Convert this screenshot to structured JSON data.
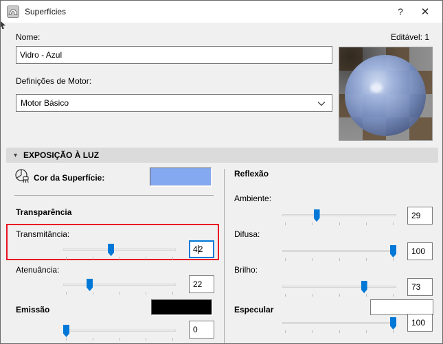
{
  "window": {
    "title": "Superfícies",
    "help_label": "?",
    "close_label": "✕"
  },
  "header": {
    "name_label": "Nome:",
    "name_value": "Vidro - Azul",
    "editable_label": "Editável: 1",
    "engine_label": "Definições de Motor:",
    "engine_value": "Motor Básico",
    "preview_name": "material-preview-sphere"
  },
  "section": {
    "title": "EXPOSIÇÃO À LUZ",
    "collapse_icon": "▾"
  },
  "left": {
    "surface_color_label": "Cor da Superfície:",
    "surface_color": "#85a9f0",
    "transparency_title": "Transparência",
    "transmittance": {
      "label": "Transmitância:",
      "value_before_caret": "4",
      "value_after_caret": "2",
      "percent": 42
    },
    "attenuation": {
      "label": "Atenuância:",
      "value": "22",
      "percent": 22
    },
    "emission_title": "Emissão",
    "emission_color": "#000000",
    "emission_slider": {
      "value": "0",
      "percent": 0
    }
  },
  "right": {
    "reflection_title": "Reflexão",
    "ambient": {
      "label": "Ambiente:",
      "value": "29",
      "percent": 29
    },
    "diffuse": {
      "label": "Difusa:",
      "value": "100",
      "percent": 100
    },
    "shine": {
      "label": "Brilho:",
      "value": "73",
      "percent": 73
    },
    "specular_title": "Especular",
    "specular_color": "#ffffff",
    "specular_slider": {
      "value": "100",
      "percent": 100
    }
  },
  "colors": {
    "accent_blue": "#0078d7",
    "highlight_red": "#e81123",
    "section_bar": "#dbdbdb",
    "dialog_bg": "#f0f0f0"
  }
}
